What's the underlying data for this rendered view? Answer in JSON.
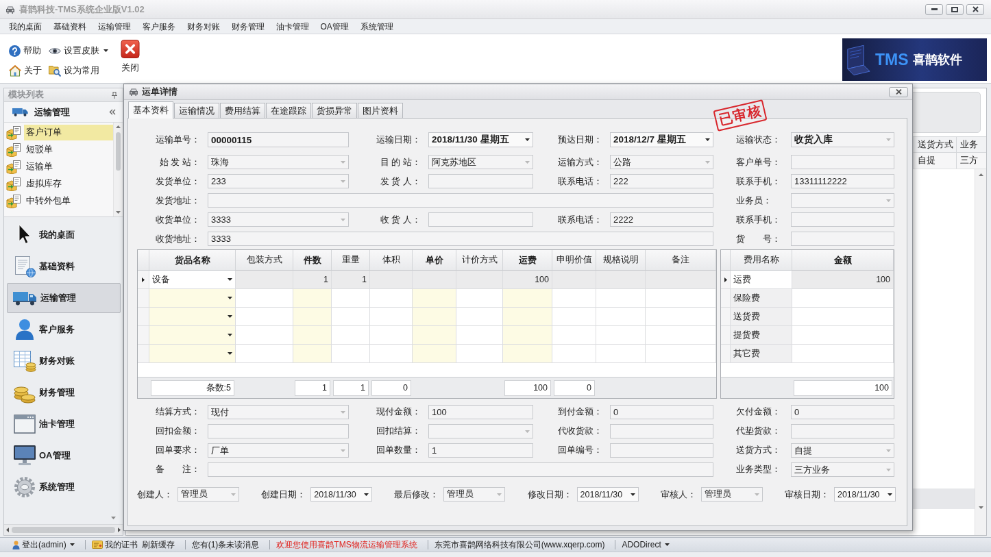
{
  "window": {
    "title": "喜鹊科技-TMS系统企业版V1.02"
  },
  "menu": [
    "我的桌面",
    "基础资料",
    "运输管理",
    "客户服务",
    "财务对账",
    "财务管理",
    "油卡管理",
    "OA管理",
    "系统管理"
  ],
  "toolbar": {
    "buttons": [
      {
        "label": "帮助",
        "dropdown": false
      },
      {
        "label": "设置皮肤",
        "dropdown": true
      },
      {
        "label": "关于",
        "dropdown": false
      },
      {
        "label": "设为常用",
        "dropdown": false
      }
    ],
    "close_button": {
      "label": "关闭"
    }
  },
  "logo": {
    "product": "TMS",
    "company": "喜鹊软件"
  },
  "sidebar": {
    "title": "模块列表",
    "group": {
      "title": "运输管理",
      "items": [
        {
          "label": "客户订单",
          "selected": true
        },
        {
          "label": "短驳单",
          "selected": false
        },
        {
          "label": "运输单",
          "selected": false
        },
        {
          "label": "虚拟库存",
          "selected": false
        },
        {
          "label": "中转外包单",
          "selected": false
        }
      ]
    },
    "modules": [
      {
        "label": "我的桌面",
        "selected": false
      },
      {
        "label": "基础资料",
        "selected": false
      },
      {
        "label": "运输管理",
        "selected": true
      },
      {
        "label": "客户服务",
        "selected": false
      },
      {
        "label": "财务对账",
        "selected": false
      },
      {
        "label": "财务管理",
        "selected": false
      },
      {
        "label": "油卡管理",
        "selected": false
      },
      {
        "label": "OA管理",
        "selected": false
      },
      {
        "label": "系统管理",
        "selected": false
      }
    ]
  },
  "background_grid": {
    "columns": [
      "送货方式",
      "业务"
    ],
    "rows": [
      [
        "自提",
        "三方"
      ]
    ]
  },
  "dialog": {
    "title": "运单详情",
    "tabs": [
      {
        "label": "基本资料",
        "selected": true
      },
      {
        "label": "运输情况",
        "selected": false
      },
      {
        "label": "费用结算",
        "selected": false
      },
      {
        "label": "在途跟踪",
        "selected": false
      },
      {
        "label": "货损异常",
        "selected": false
      },
      {
        "label": "图片资料",
        "selected": false
      }
    ],
    "approval_stamp": "已审核",
    "header_form": [
      {
        "emphasized": true,
        "fields": [
          {
            "label": "运输单号：",
            "kind": "text",
            "value": "00000115"
          },
          {
            "label": "运输日期：",
            "kind": "date",
            "value": "2018/11/30 星期五"
          },
          {
            "label": "预达日期：",
            "kind": "date",
            "value": "2018/12/7 星期五"
          },
          {
            "label": "运输状态：",
            "kind": "combo",
            "value": "收货入库"
          }
        ]
      },
      {
        "emphasized": false,
        "fields": [
          {
            "label": "始 发 站：",
            "kind": "combo",
            "value": "珠海"
          },
          {
            "label": "目 的 站：",
            "kind": "combo",
            "value": "阿克苏地区"
          },
          {
            "label": "运输方式：",
            "kind": "combo",
            "value": "公路"
          },
          {
            "label": "客户单号：",
            "kind": "text"
          }
        ]
      },
      {
        "emphasized": false,
        "fields": [
          {
            "label": "发货单位：",
            "kind": "combo",
            "value": "233"
          },
          {
            "label": "发 货 人：",
            "kind": "text"
          },
          {
            "label": "联系电话：",
            "kind": "text",
            "value": "222"
          },
          {
            "label": "联系手机：",
            "kind": "text",
            "value": "13311112222"
          }
        ]
      },
      {
        "emphasized": false,
        "fields": [
          {
            "label": "发货地址：",
            "kind": "wide"
          },
          {
            "label": "业务员：",
            "kind": "combo"
          }
        ]
      },
      {
        "emphasized": false,
        "fields": [
          {
            "label": "收货单位：",
            "kind": "combo",
            "value": "3333"
          },
          {
            "label": "收 货 人：",
            "kind": "text"
          },
          {
            "label": "联系电话：",
            "kind": "text",
            "value": "2222"
          },
          {
            "label": "联系手机：",
            "kind": "text"
          }
        ]
      },
      {
        "emphasized": false,
        "fields": [
          {
            "label": "收货地址：",
            "kind": "wide",
            "value": "3333"
          },
          {
            "label": "货　　号：",
            "kind": "text"
          }
        ]
      }
    ],
    "goods_grid": {
      "columns": [
        {
          "label": "货品名称",
          "kind": "text",
          "required": true,
          "highlighted": true,
          "dropdown": true
        },
        {
          "label": "包装方式",
          "kind": "text",
          "required": false,
          "highlighted": false
        },
        {
          "label": "件数",
          "kind": "number",
          "required": true,
          "highlighted": true
        },
        {
          "label": "重量",
          "kind": "number",
          "required": false,
          "highlighted": false
        },
        {
          "label": "体积",
          "kind": "number",
          "required": false,
          "highlighted": false
        },
        {
          "label": "单价",
          "kind": "number",
          "required": true,
          "highlighted": true
        },
        {
          "label": "计价方式",
          "kind": "text",
          "required": false,
          "highlighted": false
        },
        {
          "label": "运费",
          "kind": "number",
          "required": true,
          "highlighted": true
        },
        {
          "label": "申明价值",
          "kind": "number",
          "required": false,
          "highlighted": false
        },
        {
          "label": "规格说明",
          "kind": "text",
          "required": false,
          "highlighted": false
        },
        {
          "label": "备注",
          "kind": "text",
          "required": false,
          "highlighted": false
        }
      ],
      "rows": [
        {
          "selected": true,
          "cells": [
            "设备",
            null,
            "1",
            "1",
            null,
            null,
            null,
            "100"
          ]
        },
        {
          "selected": false
        },
        {
          "selected": false
        },
        {
          "selected": false
        },
        {
          "selected": false
        }
      ],
      "footer": [
        {
          "kind": "total",
          "text": "条数:5"
        },
        {
          "kind": "blank"
        },
        {
          "kind": "total",
          "text": "1"
        },
        {
          "kind": "total",
          "text": "1"
        },
        {
          "kind": "total",
          "text": "0"
        },
        {
          "kind": "blank"
        },
        {
          "kind": "blank"
        },
        {
          "kind": "total",
          "text": "100"
        },
        {
          "kind": "total",
          "text": "0"
        }
      ]
    },
    "fee_grid": {
      "columns": [
        {
          "label": "费用名称",
          "kind": "text",
          "required": false,
          "readonly": true
        },
        {
          "label": "金额",
          "kind": "number",
          "required": true,
          "readonly": false
        }
      ],
      "rows": [
        {
          "selected": true,
          "cells": [
            "运费",
            "100"
          ]
        },
        {
          "selected": false,
          "cells": [
            "保险费"
          ]
        },
        {
          "selected": false,
          "cells": [
            "送货费"
          ]
        },
        {
          "selected": false,
          "cells": [
            "提货费"
          ]
        },
        {
          "selected": false,
          "cells": [
            "其它费"
          ]
        }
      ],
      "footer": [
        {
          "kind": "blank"
        },
        {
          "kind": "total",
          "text": "100"
        }
      ]
    },
    "bottom_form": [
      {
        "fields": [
          {
            "label": "结算方式：",
            "kind": "combo",
            "value": "现付"
          },
          {
            "label": "现付金额：",
            "kind": "text",
            "value": "100"
          },
          {
            "label": "到付金额：",
            "kind": "text",
            "value": "0"
          },
          {
            "label": "欠付金额：",
            "kind": "text",
            "value": "0"
          }
        ]
      },
      {
        "fields": [
          {
            "label": "回扣金额：",
            "kind": "text"
          },
          {
            "label": "回扣结算：",
            "kind": "combo"
          },
          {
            "label": "代收货款：",
            "kind": "text"
          },
          {
            "label": "代垫货款：",
            "kind": "text"
          }
        ]
      },
      {
        "fields": [
          {
            "label": "回单要求：",
            "kind": "combo",
            "value": "厂单"
          },
          {
            "label": "回单数量：",
            "kind": "text",
            "value": "1"
          },
          {
            "label": "回单编号：",
            "kind": "text"
          },
          {
            "label": "送货方式：",
            "kind": "combo",
            "value": "自提"
          }
        ]
      },
      {
        "fields": [
          {
            "label": "备　　注：",
            "kind": "wide"
          },
          {
            "label": "业务类型：",
            "kind": "combo",
            "value": "三方业务"
          }
        ]
      }
    ],
    "record_row": [
      {
        "label": "创建人：",
        "kind": "combo",
        "value": "管理员"
      },
      {
        "label": "创建日期：",
        "kind": "date",
        "value": "2018/11/30"
      },
      {
        "label": "最后修改：",
        "kind": "combo",
        "value": "管理员"
      },
      {
        "label": "修改日期：",
        "kind": "date",
        "value": "2018/11/30"
      },
      {
        "label": "审核人：",
        "kind": "combo",
        "value": "管理员"
      },
      {
        "label": "审核日期：",
        "kind": "date",
        "value": "2018/11/30"
      }
    ]
  },
  "status_bar": {
    "groups": [
      {
        "items": [
          {
            "label": "登出(admin)",
            "dropdown": true,
            "highlighted": false
          }
        ]
      },
      {
        "items": [
          {
            "label": "我的证书",
            "dropdown": false,
            "highlighted": false
          },
          {
            "label": "刷新缓存",
            "dropdown": false,
            "highlighted": false
          }
        ]
      },
      {
        "items": [
          {
            "label": "您有(1)条未读消息",
            "dropdown": false,
            "highlighted": false
          }
        ]
      },
      {
        "items": [
          {
            "label": "欢迎您使用喜鹊TMS物流运输管理系统",
            "dropdown": false,
            "highlighted": true
          }
        ]
      },
      {
        "items": [
          {
            "label": "东莞市喜鹊网络科技有限公司(www.xqerp.com)",
            "dropdown": false,
            "highlighted": false
          }
        ]
      },
      {
        "items": [
          {
            "label": "ADODirect",
            "dropdown": true,
            "highlighted": false
          }
        ]
      }
    ]
  }
}
